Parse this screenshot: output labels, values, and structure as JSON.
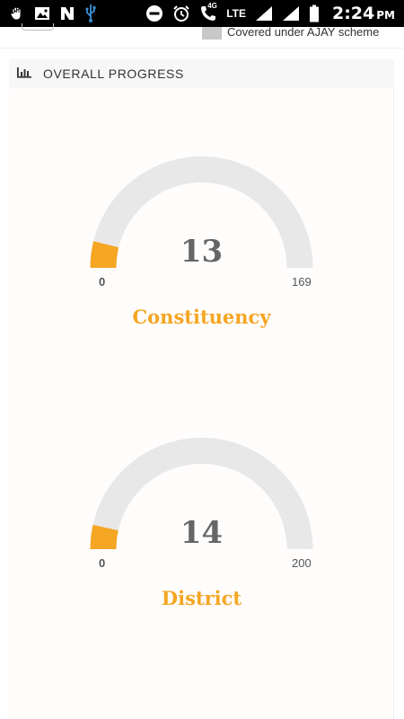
{
  "status_bar": {
    "time": "2:24",
    "ampm": "PM",
    "network_tag": "4G",
    "network_type": "LTE",
    "icons": [
      "hand-icon",
      "image-icon",
      "n-icon",
      "usb-icon",
      "dnd-icon",
      "alarm-icon",
      "call-icon",
      "signal-icon",
      "signal-icon-2",
      "battery-icon"
    ]
  },
  "legend": {
    "item_label": "Covered under  AJAY  scheme",
    "swatch_color": "#c8c8c8"
  },
  "card": {
    "title": "OVERALL PROGRESS",
    "icon": "bar-chart-icon"
  },
  "colors": {
    "accent": "#f5a623",
    "track": "#e8e8e8",
    "value_text": "#666666"
  },
  "gauges": [
    {
      "label": "Constituency",
      "value": "13",
      "min": "0",
      "max": "169",
      "fraction": 0.0769
    },
    {
      "label": "District",
      "value": "14",
      "min": "0",
      "max": "200",
      "fraction": 0.07
    }
  ]
}
